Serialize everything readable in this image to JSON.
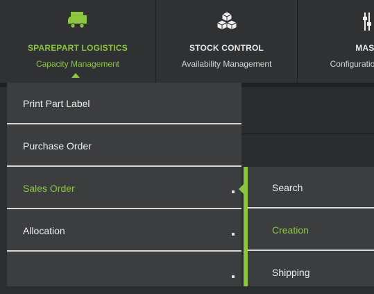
{
  "topnav": {
    "items": [
      {
        "title": "SPAREPART LOGISTICS",
        "subtitle": "Capacity Management",
        "icon": "truck-icon",
        "active": true
      },
      {
        "title": "STOCK CONTROL",
        "subtitle": "Availability Management",
        "icon": "boxes-icon",
        "active": false
      },
      {
        "title": "MAST",
        "subtitle": "Configuration",
        "icon": "sliders-icon",
        "active": false
      }
    ]
  },
  "menu": {
    "items": [
      {
        "label": "Print Part Label",
        "has_submenu": false,
        "active": false
      },
      {
        "label": "Purchase Order",
        "has_submenu": false,
        "active": false
      },
      {
        "label": "Sales Order",
        "has_submenu": true,
        "active": true
      },
      {
        "label": "Allocation",
        "has_submenu": true,
        "active": false
      },
      {
        "label": "",
        "has_submenu": true,
        "active": false
      }
    ]
  },
  "submenu": {
    "items": [
      {
        "label": "Search",
        "active": false
      },
      {
        "label": "Creation",
        "active": true
      },
      {
        "label": "Shipping",
        "active": false
      }
    ]
  },
  "colors": {
    "accent": "#8cc63f",
    "background": "#2f3133",
    "menu_bg": "#3b3d3f",
    "text": "#ededed"
  }
}
